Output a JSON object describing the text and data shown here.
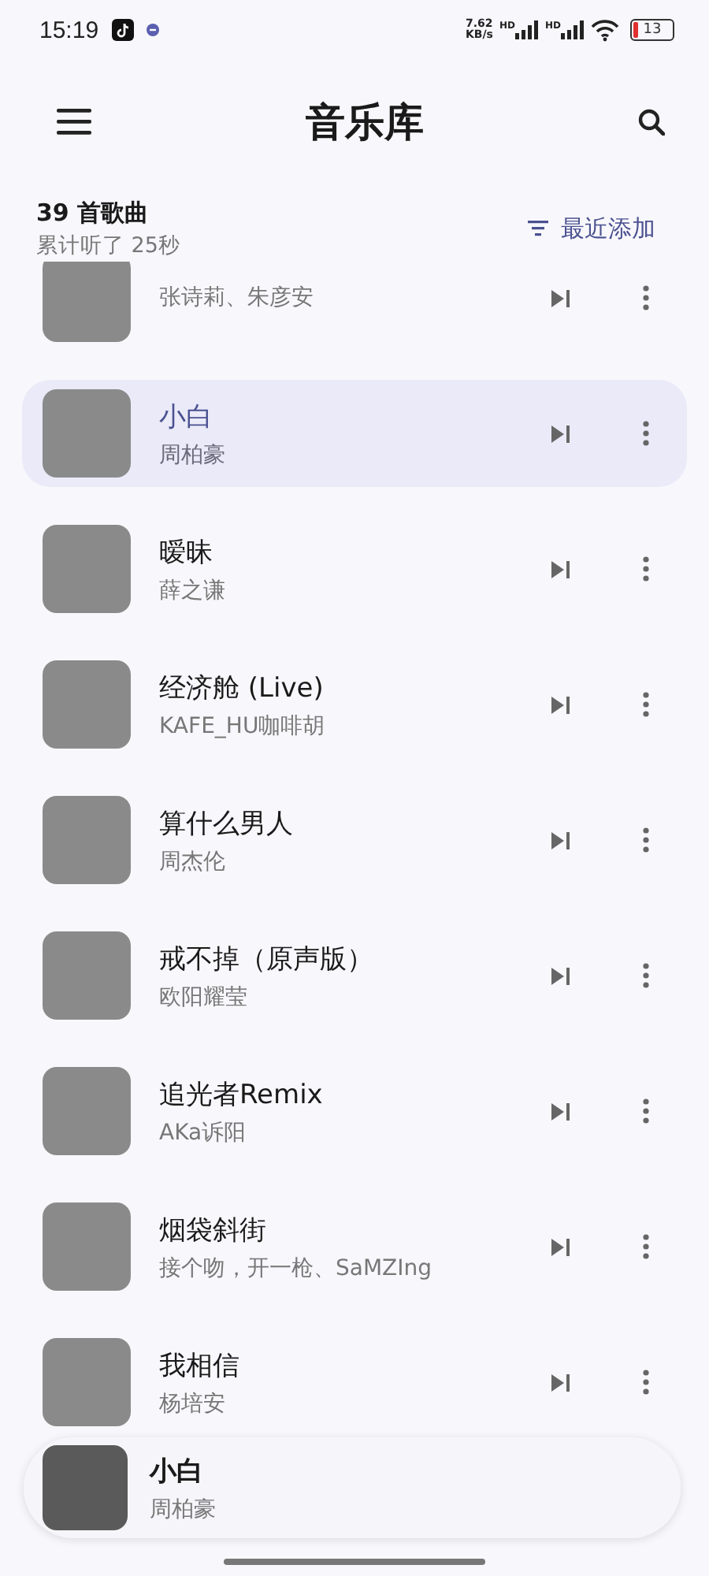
{
  "status_bar": {
    "time": "15:19",
    "net_speed": "7.62",
    "net_unit": "KB/s",
    "sim": [
      "HD",
      "HD"
    ],
    "battery": "13"
  },
  "header": {
    "title": "音乐库"
  },
  "summary": {
    "count": "39 首歌曲",
    "listened": "累计听了 25秒",
    "sort": "最近添加"
  },
  "songs": [
    {
      "artist": "张诗莉、朱彦安",
      "selected": false
    },
    {
      "title": "小白",
      "artist": "周柏豪",
      "selected": true
    },
    {
      "title": "暧昧",
      "artist": "薛之谦",
      "selected": false
    },
    {
      "title": "经济舱 (Live)",
      "artist": "KAFE_HU咖啡胡",
      "selected": false
    },
    {
      "title": "算什么男人",
      "artist": "周杰伦",
      "selected": false
    },
    {
      "title": "戒不掉（原声版）",
      "artist": "欧阳耀莹",
      "selected": false
    },
    {
      "title": "追光者Remix",
      "artist": "AKa诉阳",
      "selected": false
    },
    {
      "title": "烟袋斜街",
      "artist": "接个吻，开一枪、SaMZIng",
      "selected": false
    },
    {
      "title": "我相信",
      "artist": "杨培安",
      "selected": false
    }
  ],
  "mini_player": {
    "title": "小白",
    "artist": "周柏豪"
  }
}
